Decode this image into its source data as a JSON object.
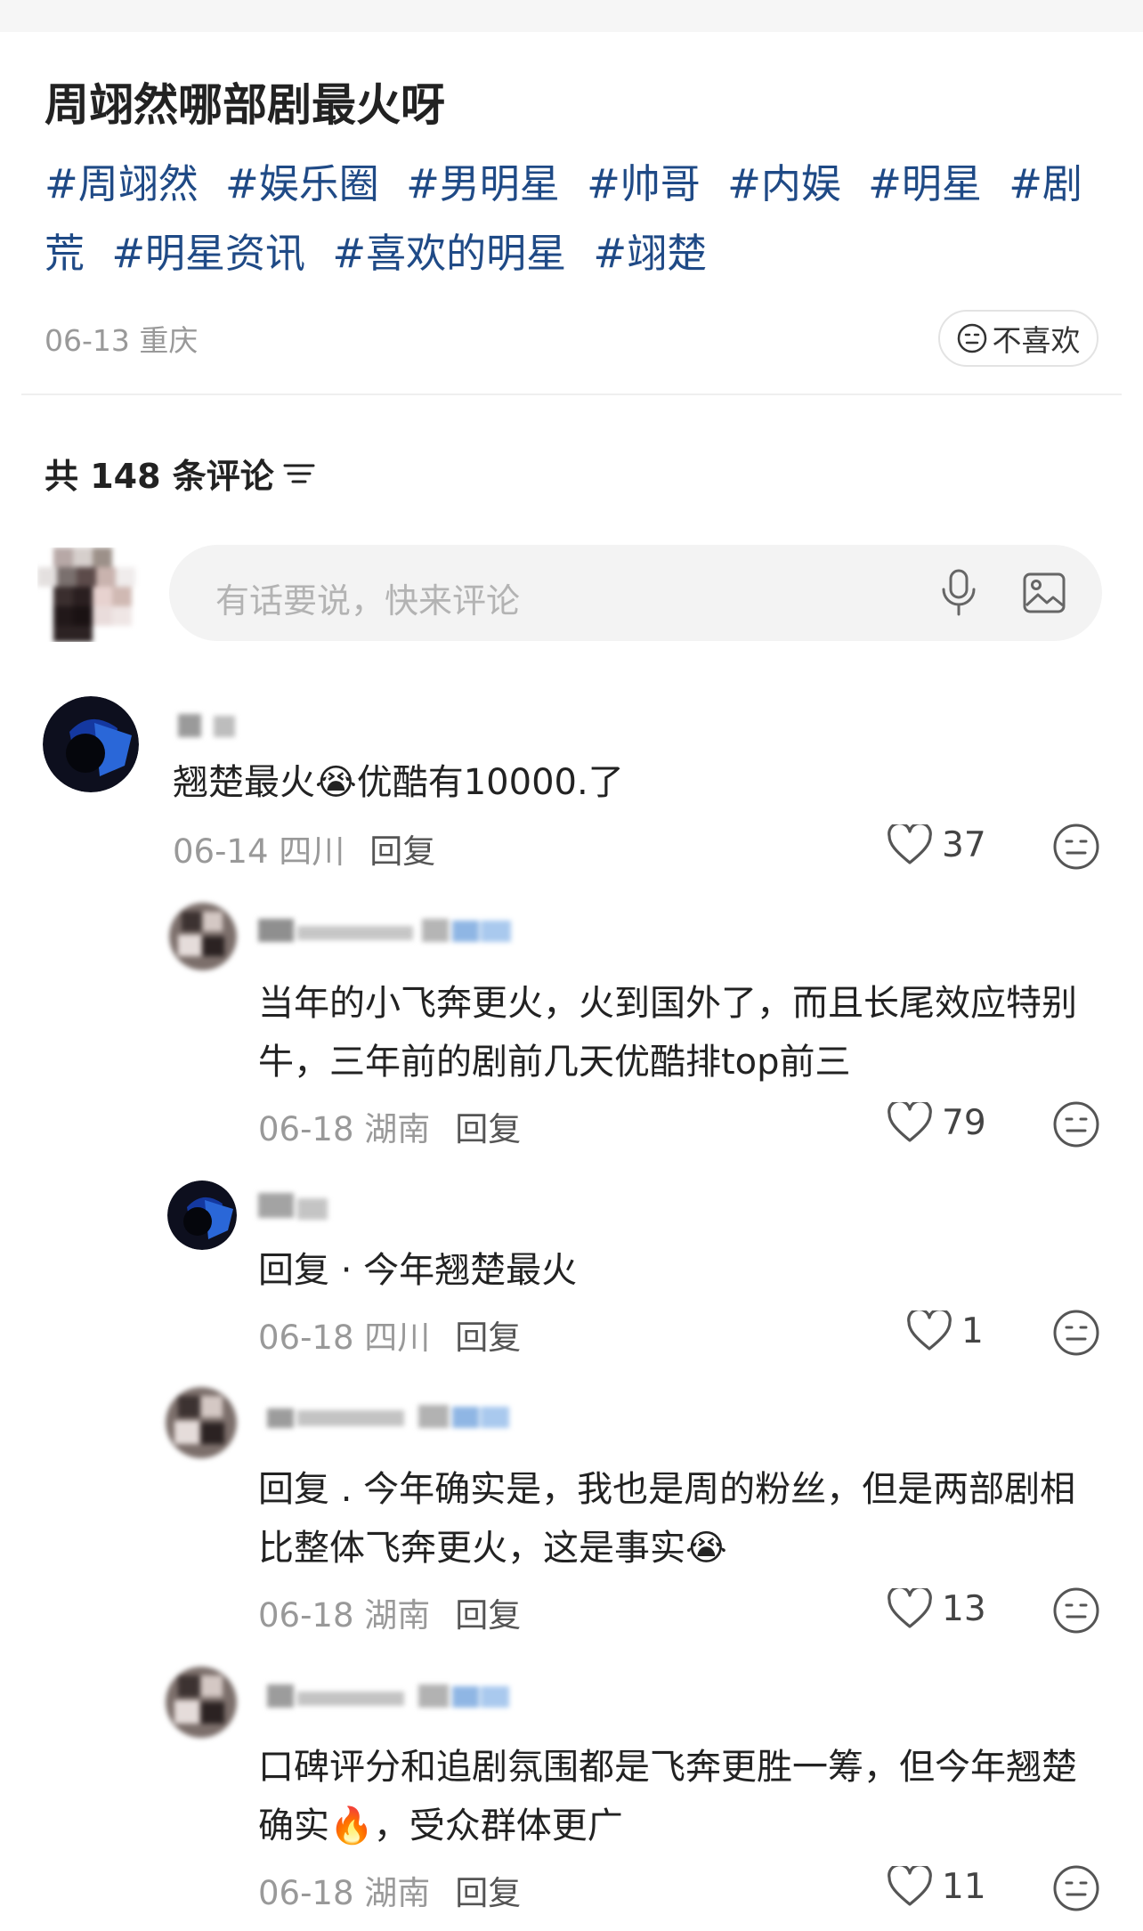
{
  "post": {
    "title": "周翊然哪部剧最火呀",
    "tags": [
      "#周翊然",
      "#娱乐圈",
      "#男明星",
      "#帅哥",
      "#内娱",
      "#明星",
      "#剧荒",
      "#明星资讯",
      "#喜欢的明星",
      "#翊楚"
    ],
    "date_location": "06-13 重庆",
    "dislike_label": "不喜欢"
  },
  "comments_header": {
    "count_label": "共 148 条评论"
  },
  "comment_input": {
    "placeholder": "有话要说，快来评论"
  },
  "comments": [
    {
      "text": "翘楚最火😭优酷有10000.了",
      "meta": "06-14 四川",
      "reply_label": "回复",
      "likes": "37"
    },
    {
      "text": "当年的小飞奔更火，火到国外了，而且长尾效应特别牛，三年前的剧前几天优酷排top前三",
      "meta": "06-18 湖南",
      "reply_label": "回复",
      "likes": "79"
    },
    {
      "text": "回复 · 今年翘楚最火",
      "meta": "06-18 四川",
      "reply_label": "回复",
      "likes": "1"
    },
    {
      "text": "回复 . 今年确实是，我也是周的粉丝，但是两部剧相比整体飞奔更火，这是事实😭",
      "meta": "06-18 湖南",
      "reply_label": "回复",
      "likes": "13"
    },
    {
      "text": "口碑评分和追剧氛围都是飞奔更胜一筹，但今年翘楚确实🔥，受众群体更广",
      "meta": "06-18 湖南",
      "reply_label": "回复",
      "likes": "11"
    }
  ],
  "icons": {
    "dislike": "meh-face-icon",
    "filter": "filter-lines-icon",
    "mic": "microphone-icon",
    "image": "image-icon",
    "like": "heart-outline-icon",
    "meh": "meh-face-icon"
  }
}
